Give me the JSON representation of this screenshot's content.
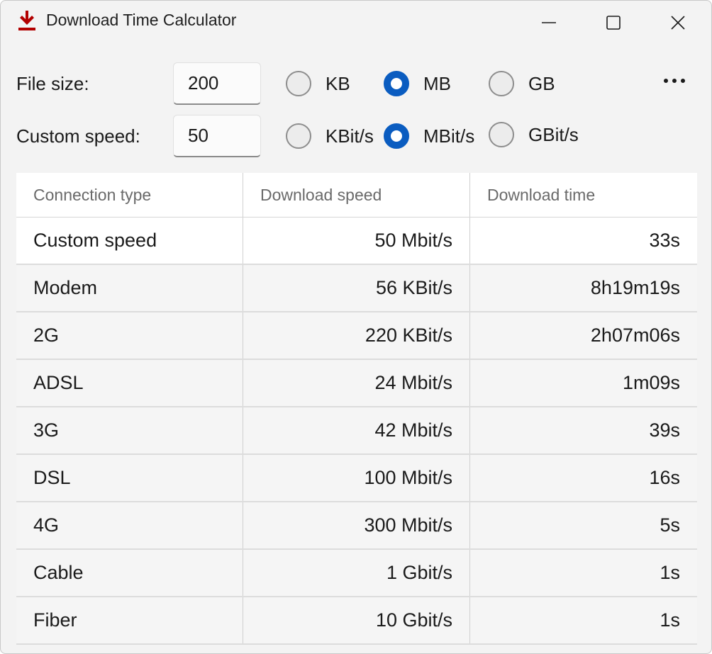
{
  "window": {
    "title": "Download Time Calculator",
    "icon": "download-arrow-icon",
    "accent": "#b20000"
  },
  "form": {
    "file_size_label": "File size:",
    "file_size_value": "200",
    "size_units": [
      "KB",
      "MB",
      "GB"
    ],
    "size_selected": "MB",
    "speed_label": "Custom speed:",
    "speed_value": "50",
    "speed_units": [
      "KBit/s",
      "MBit/s",
      "GBit/s"
    ],
    "speed_selected": "MBit/s",
    "radio_accent": "#0a5cc0"
  },
  "table": {
    "headers": [
      "Connection type",
      "Download speed",
      "Download time"
    ],
    "rows": [
      [
        "Custom speed",
        "50 Mbit/s",
        "33s"
      ],
      [
        "Modem",
        "56 KBit/s",
        "8h19m19s"
      ],
      [
        "2G",
        "220 KBit/s",
        "2h07m06s"
      ],
      [
        "ADSL",
        "24 Mbit/s",
        "1m09s"
      ],
      [
        "3G",
        "42 Mbit/s",
        "39s"
      ],
      [
        "DSL",
        "100 Mbit/s",
        "16s"
      ],
      [
        "4G",
        "300 Mbit/s",
        "5s"
      ],
      [
        "Cable",
        "1 Gbit/s",
        "1s"
      ],
      [
        "Fiber",
        "10 Gbit/s",
        "1s"
      ]
    ]
  }
}
